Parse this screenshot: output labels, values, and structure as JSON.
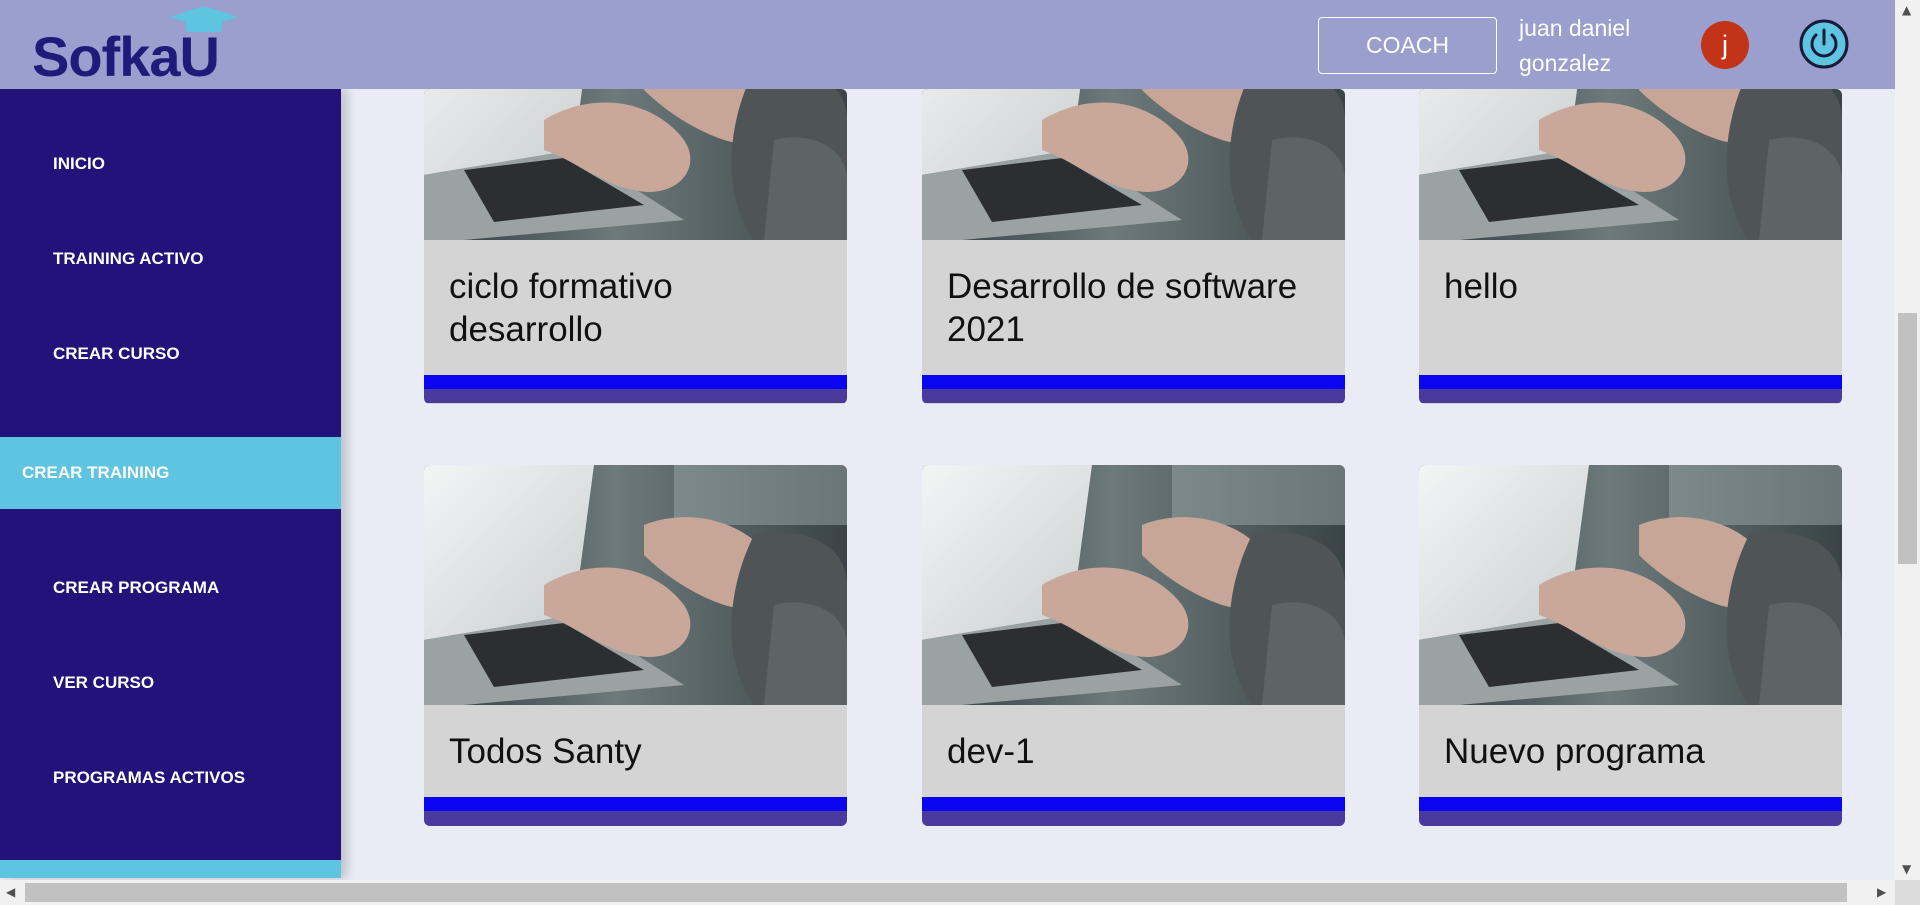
{
  "header": {
    "logo_text": "SofkaU",
    "coach_label": "COACH",
    "user_name": "juan daniel gonzalez",
    "avatar_initial": "j",
    "power_icon": "power-icon"
  },
  "sidebar": {
    "items": [
      {
        "label": "INICIO"
      },
      {
        "label": "TRAINING ACTIVO"
      },
      {
        "label": "CREAR CURSO"
      },
      {
        "label": "CREAR TRAINING",
        "active": true
      },
      {
        "label": "CREAR PROGRAMA"
      },
      {
        "label": "VER CURSO"
      },
      {
        "label": "PROGRAMAS ACTIVOS"
      }
    ]
  },
  "cards": [
    {
      "title": "ciclo formativo desarrollo"
    },
    {
      "title": "Desarrollo de software 2021"
    },
    {
      "title": "hello"
    },
    {
      "title": "Todos Santy"
    },
    {
      "title": "dev-1"
    },
    {
      "title": "Nuevo programa"
    }
  ],
  "colors": {
    "header_bg": "#9a9fcd",
    "sidebar_bg": "#22127a",
    "active_item_bg": "#5ec4e0",
    "card_bar": "#0a05f0",
    "avatar_bg": "#c23317"
  }
}
